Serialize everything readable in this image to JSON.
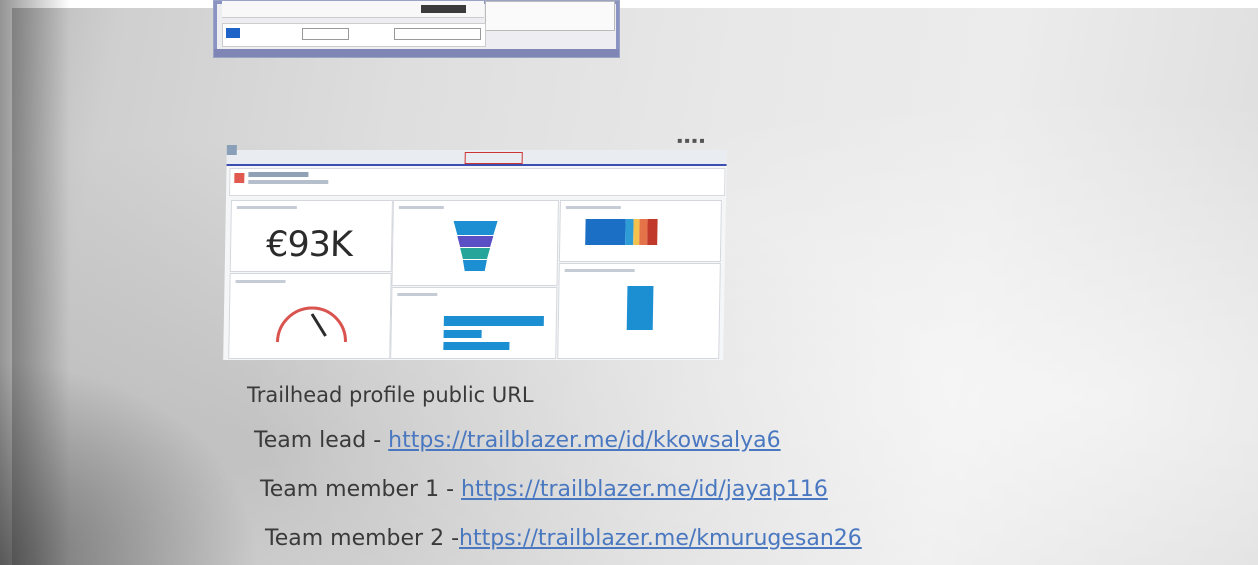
{
  "dashboard": {
    "metric_value": "€93K"
  },
  "document": {
    "heading": "Trailhead profile public URL",
    "rows": [
      {
        "label": "Team lead - ",
        "url": "https://trailblazer.me/id/kkowsalya6"
      },
      {
        "label": "Team member 1 - ",
        "url": "https://trailblazer.me/id/jayap116"
      },
      {
        "label": "Team member 2 -",
        "url": "https://trailblazer.me/kmurugesan26"
      }
    ]
  },
  "colors": {
    "link": "#4a78c0",
    "chart_blue": "#1b8fd2",
    "gauge_needle": "#2b2b2b"
  }
}
